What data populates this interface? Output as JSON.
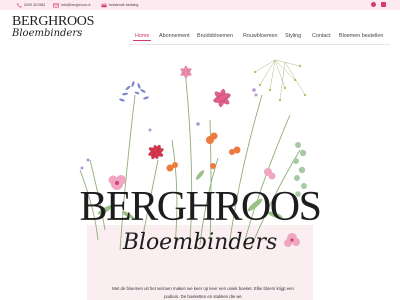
{
  "topbar": {
    "phone": "0299 421983",
    "email": "info@berghroos.nl",
    "payment": "betalende betaling"
  },
  "logo": {
    "line1": "BERGHROOS",
    "line2": "Bloembinders"
  },
  "nav": {
    "items": [
      {
        "label": "Home",
        "active": true
      },
      {
        "label": "Abonnement"
      },
      {
        "label": "Bruidsbloemen"
      },
      {
        "label": "Rouwbloemen"
      },
      {
        "label": "Styling"
      },
      {
        "label": "Contact"
      },
      {
        "label": "Bloemen bestellen"
      }
    ]
  },
  "hero": {
    "brand": "BERGHROOS",
    "script": "Bloembinders",
    "intro": "Met de bloemen uit het seizoen maken we keer op keer een uniek boeket. Elke bloem krijgt een podium. De boeketten en stukken die we"
  },
  "colors": {
    "accent": "#d23a68",
    "topbar_bg": "#fdeaf1",
    "panel_bg": "#fbeef1"
  }
}
